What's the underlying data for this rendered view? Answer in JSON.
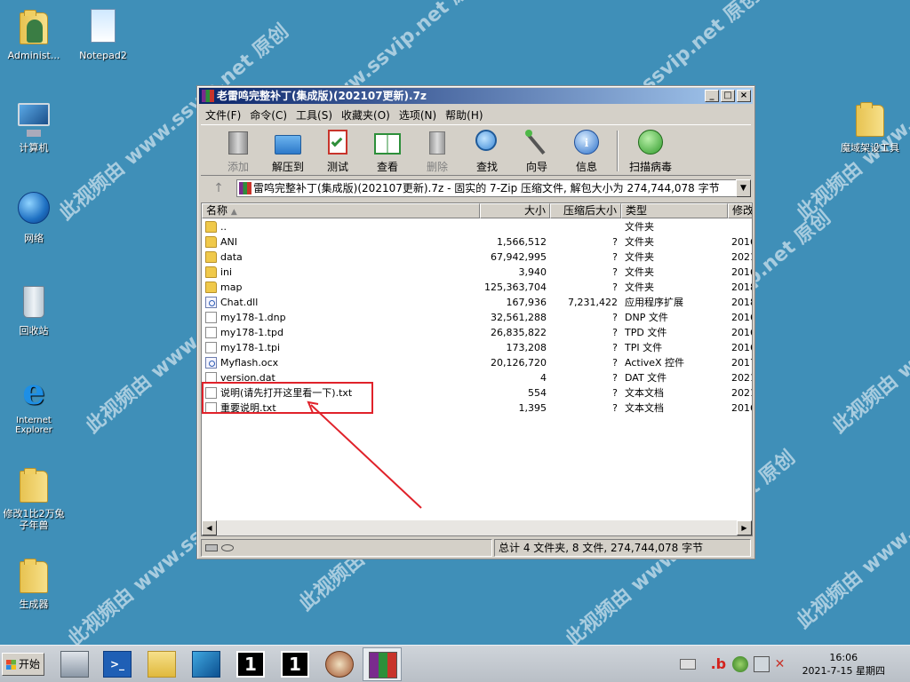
{
  "watermark_text": "此视频由 www.ssvip.net 原创",
  "desktop": {
    "icons": [
      {
        "label": "Administ..."
      },
      {
        "label": "Notepad2"
      },
      {
        "label": "计算机"
      },
      {
        "label": "网络"
      },
      {
        "label": "回收站"
      },
      {
        "label": "Internet Explorer"
      },
      {
        "label": "修改1比2万兔子年兽"
      },
      {
        "label": "生成器"
      },
      {
        "label": "魔域架设工具"
      }
    ]
  },
  "window": {
    "title": "老雷鸣完整补丁(集成版)(202107更新).7z",
    "buttons": {
      "minimize": "_",
      "maximize": "□",
      "close": "×"
    },
    "menu": [
      "文件(F)",
      "命令(C)",
      "工具(S)",
      "收藏夹(O)",
      "选项(N)",
      "帮助(H)"
    ],
    "toolbar": [
      "添加",
      "解压到",
      "测试",
      "查看",
      "删除",
      "查找",
      "向导",
      "信息",
      "扫描病毒"
    ],
    "address": "雷鸣完整补丁(集成版)(202107更新).7z - 固实的 7-Zip 压缩文件, 解包大小为 274,744,078 字节",
    "up_arrow": "↑",
    "dropdown": "▼",
    "columns": [
      "名称",
      "大小",
      "压缩后大小",
      "类型",
      "修改"
    ],
    "files": [
      {
        "name": "..",
        "size": "",
        "packed": "",
        "type": "文件夹",
        "modified": "",
        "icon": "folder"
      },
      {
        "name": "ANI",
        "size": "1,566,512",
        "packed": "?",
        "type": "文件夹",
        "modified": "2016",
        "icon": "folder"
      },
      {
        "name": "data",
        "size": "67,942,995",
        "packed": "?",
        "type": "文件夹",
        "modified": "2021",
        "icon": "folder"
      },
      {
        "name": "ini",
        "size": "3,940",
        "packed": "?",
        "type": "文件夹",
        "modified": "2016",
        "icon": "folder"
      },
      {
        "name": "map",
        "size": "125,363,704",
        "packed": "?",
        "type": "文件夹",
        "modified": "2018",
        "icon": "folder"
      },
      {
        "name": "Chat.dll",
        "size": "167,936",
        "packed": "7,231,422",
        "type": "应用程序扩展",
        "modified": "2018",
        "icon": "dll"
      },
      {
        "name": "my178-1.dnp",
        "size": "32,561,288",
        "packed": "?",
        "type": "DNP 文件",
        "modified": "2016",
        "icon": "file"
      },
      {
        "name": "my178-1.tpd",
        "size": "26,835,822",
        "packed": "?",
        "type": "TPD 文件",
        "modified": "2016",
        "icon": "file"
      },
      {
        "name": "my178-1.tpi",
        "size": "173,208",
        "packed": "?",
        "type": "TPI 文件",
        "modified": "2016",
        "icon": "file"
      },
      {
        "name": "Myflash.ocx",
        "size": "20,126,720",
        "packed": "?",
        "type": "ActiveX 控件",
        "modified": "2017",
        "icon": "dll"
      },
      {
        "name": "version.dat",
        "size": "4",
        "packed": "?",
        "type": "DAT 文件",
        "modified": "2021",
        "icon": "file"
      },
      {
        "name": "说明(请先打开这里看一下).txt",
        "size": "554",
        "packed": "?",
        "type": "文本文档",
        "modified": "2021",
        "icon": "file"
      },
      {
        "name": "重要说明.txt",
        "size": "1,395",
        "packed": "?",
        "type": "文本文档",
        "modified": "2016",
        "icon": "file"
      }
    ],
    "status": "总计 4 文件夹, 8 文件, 274,744,078 字节"
  },
  "taskbar": {
    "start_label": "开始",
    "clock_time": "16:06",
    "clock_date": "2021-7-15 星期四"
  },
  "colors": {
    "desktop": "#3f8fb8",
    "title_active": "#0a246a",
    "annotation": "#e0222a"
  }
}
